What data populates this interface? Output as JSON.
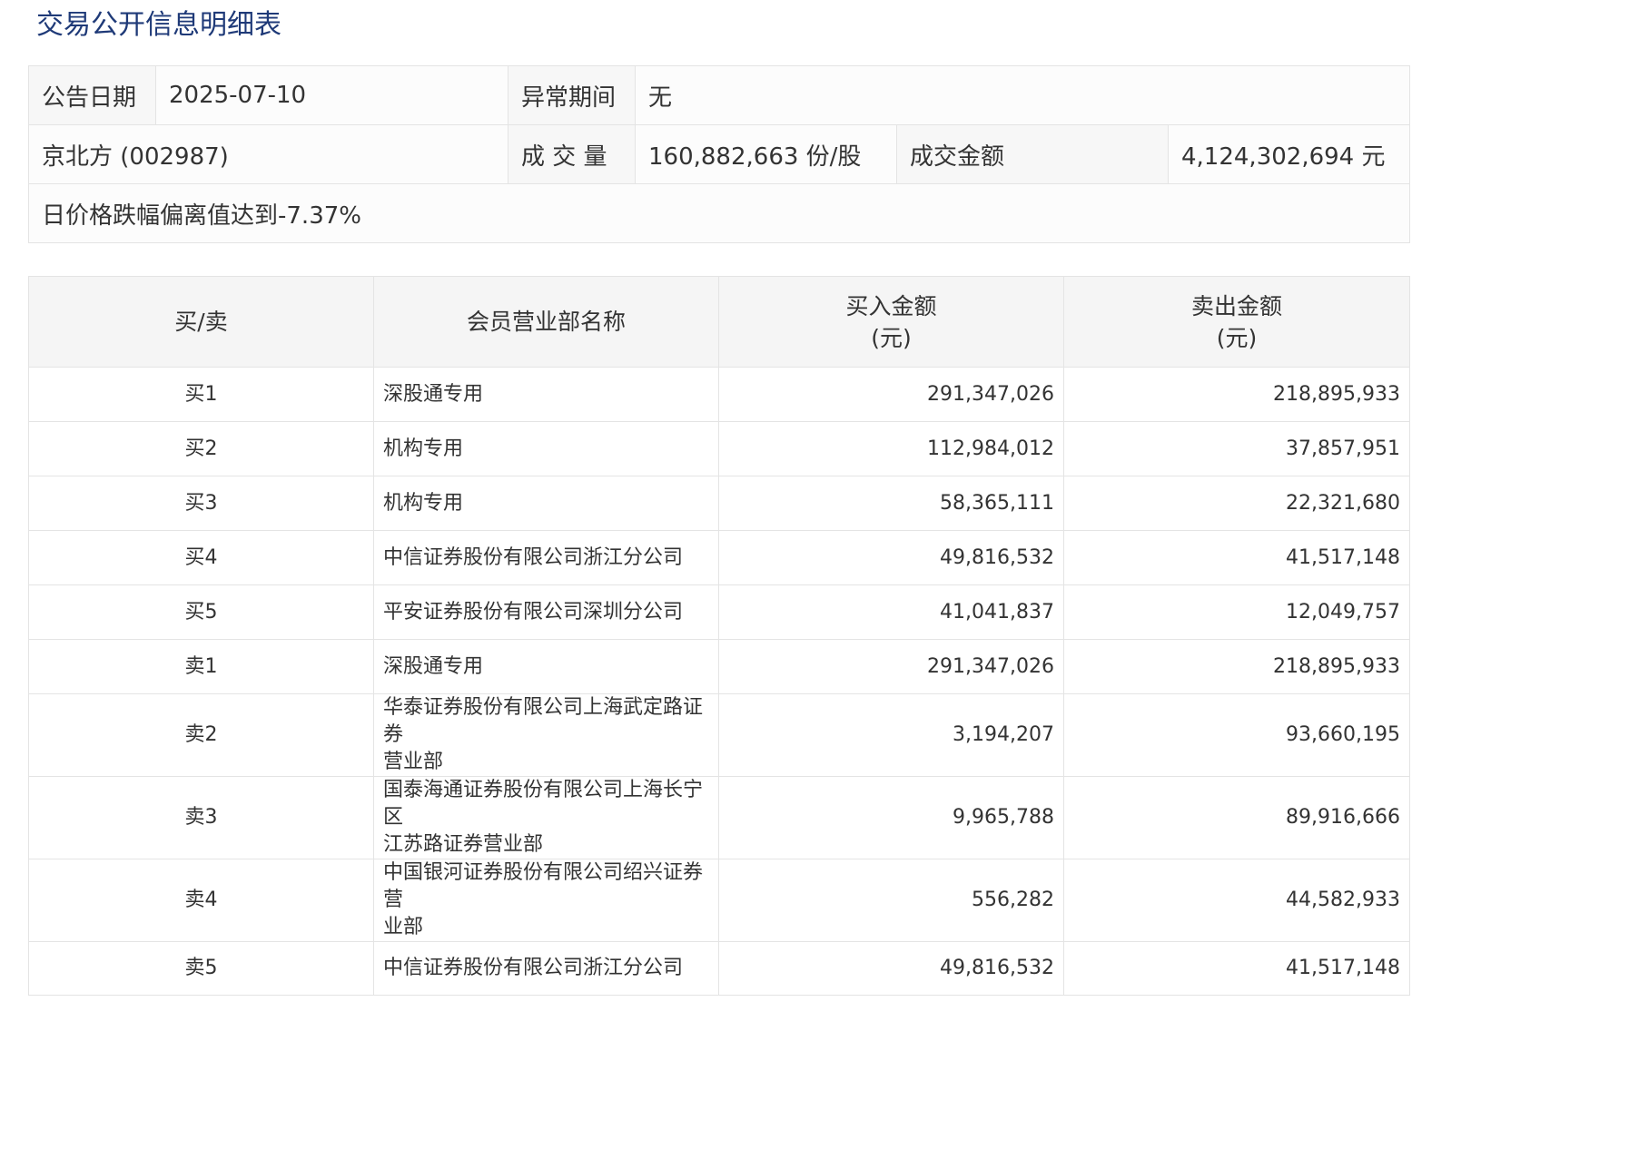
{
  "title": "交易公开信息明细表",
  "info": {
    "announce_date_label": "公告日期",
    "announce_date": "2025-07-10",
    "abnormal_period_label": "异常期间",
    "abnormal_period": "无",
    "stock": "京北方 (002987)",
    "volume_label": "成 交 量",
    "volume": "160,882,663 份/股",
    "amount_label": "成交金额",
    "amount": "4,124,302,694 元",
    "reason": "日价格跌幅偏离值达到-7.37%"
  },
  "table": {
    "headers": {
      "side": "买/卖",
      "branch": "会员营业部名称",
      "buy_line1": "买入金额",
      "buy_line2": "(元)",
      "sell_line1": "卖出金额",
      "sell_line2": "(元)"
    },
    "rows": [
      {
        "side": "买1",
        "branch_line1": "深股通专用",
        "branch_line2": "",
        "buy": "291,347,026",
        "sell": "218,895,933"
      },
      {
        "side": "买2",
        "branch_line1": "机构专用",
        "branch_line2": "",
        "buy": "112,984,012",
        "sell": "37,857,951"
      },
      {
        "side": "买3",
        "branch_line1": "机构专用",
        "branch_line2": "",
        "buy": "58,365,111",
        "sell": "22,321,680"
      },
      {
        "side": "买4",
        "branch_line1": "中信证券股份有限公司浙江分公司",
        "branch_line2": "",
        "buy": "49,816,532",
        "sell": "41,517,148"
      },
      {
        "side": "买5",
        "branch_line1": "平安证券股份有限公司深圳分公司",
        "branch_line2": "",
        "buy": "41,041,837",
        "sell": "12,049,757"
      },
      {
        "side": "卖1",
        "branch_line1": "深股通专用",
        "branch_line2": "",
        "buy": "291,347,026",
        "sell": "218,895,933"
      },
      {
        "side": "卖2",
        "branch_line1": "华泰证券股份有限公司上海武定路证券",
        "branch_line2": "营业部",
        "buy": "3,194,207",
        "sell": "93,660,195"
      },
      {
        "side": "卖3",
        "branch_line1": "国泰海通证券股份有限公司上海长宁区",
        "branch_line2": "江苏路证券营业部",
        "buy": "9,965,788",
        "sell": "89,916,666"
      },
      {
        "side": "卖4",
        "branch_line1": "中国银河证券股份有限公司绍兴证券营",
        "branch_line2": "业部",
        "buy": "556,282",
        "sell": "44,582,933"
      },
      {
        "side": "卖5",
        "branch_line1": "中信证券股份有限公司浙江分公司",
        "branch_line2": "",
        "buy": "49,816,532",
        "sell": "41,517,148"
      }
    ]
  }
}
